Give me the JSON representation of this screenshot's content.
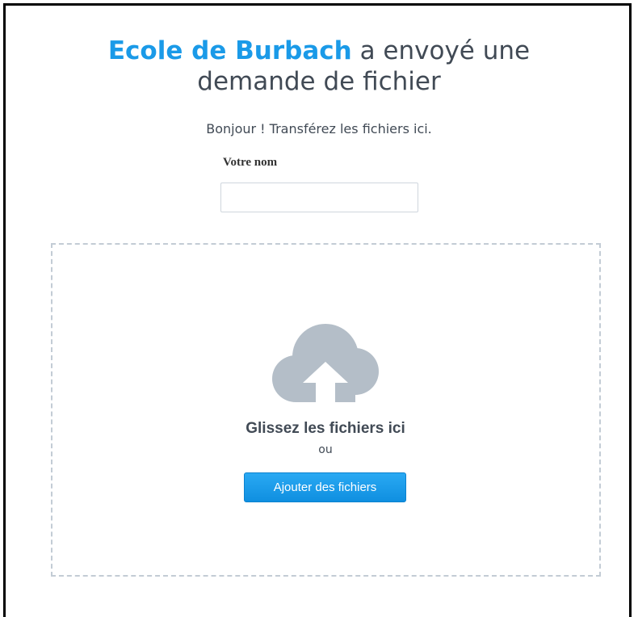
{
  "header": {
    "org_name": "Ecole de Burbach",
    "title_rest_line1": " a envoyé une",
    "title_line2": "demande de fichier",
    "greeting": "Bonjour ! Transférez les fichiers ici."
  },
  "form": {
    "name_label": "Votre nom",
    "name_value": "",
    "name_placeholder": ""
  },
  "dropzone": {
    "icon": "cloud-upload-icon",
    "drop_text": "Glissez les fichiers ici",
    "or_text": "ou",
    "add_button_label": "Ajouter des fichiers"
  },
  "colors": {
    "accent": "#1a9ae8",
    "text": "#414a55",
    "cloud": "#b4bec8",
    "dropzone_border": "#c3ccd5"
  }
}
